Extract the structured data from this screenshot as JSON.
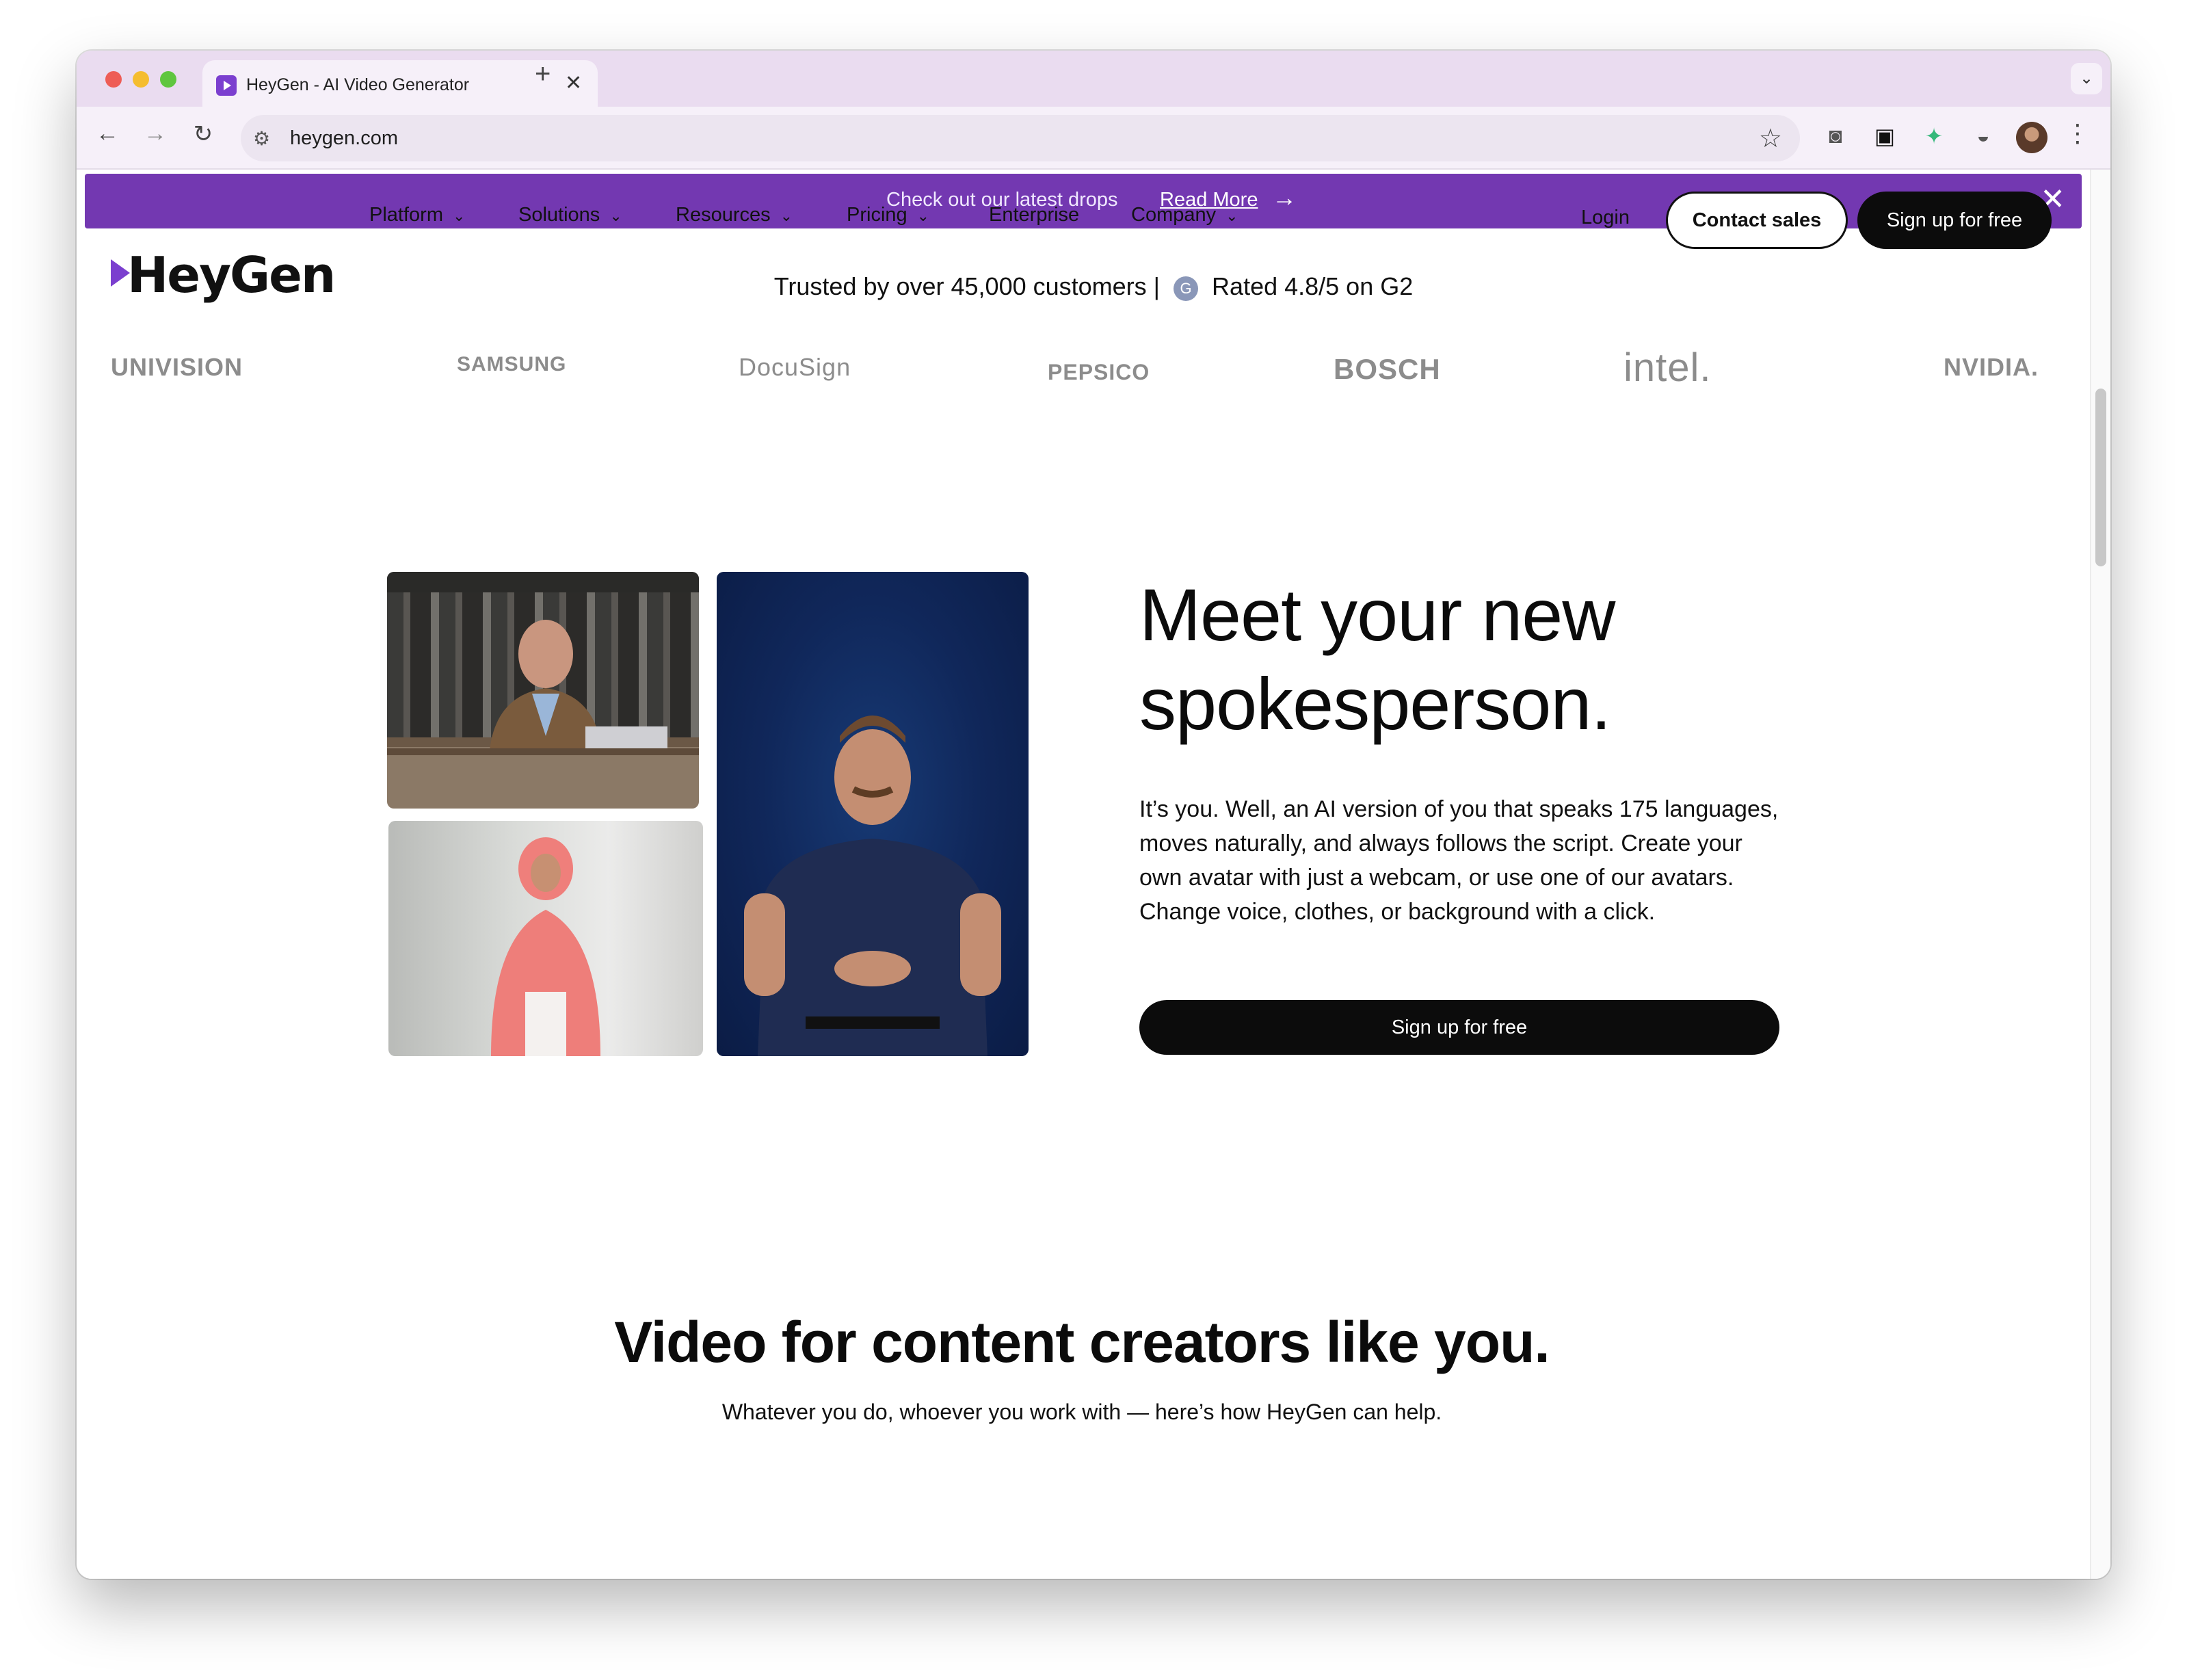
{
  "browser": {
    "tab_title": "HeyGen - AI Video Generator",
    "url": "heygen.com"
  },
  "banner": {
    "text": "Check out our latest drops",
    "link": "Read More"
  },
  "nav": {
    "logo": "HeyGen",
    "items": [
      "Platform",
      "Solutions",
      "Resources",
      "Pricing",
      "Enterprise",
      "Company"
    ],
    "login": "Login",
    "contact": "Contact sales",
    "signup": "Sign up for free"
  },
  "trust": {
    "customers": "Trusted by over 45,000 customers |",
    "rating": "Rated 4.8/5 on G2",
    "g2_badge": "G"
  },
  "logos": [
    "UNIVISION",
    "SAMSUNG",
    "DocuSign",
    "PEPSICO",
    "BOSCH",
    "intel.",
    "NVIDIA."
  ],
  "hero": {
    "title": "Meet your new spokesperson.",
    "body": "It’s you. Well, an AI version of you that speaks 175 languages, moves naturally, and always follows the script. Create your own avatar with just a webcam, or use one of our avatars. Change voice, clothes, or background with a click.",
    "cta": "Sign up for free"
  },
  "section": {
    "title": "Video for content creators like you.",
    "subtitle": "Whatever you do, whoever you work with — here’s how HeyGen can help."
  },
  "colors": {
    "banner": "#7338b1",
    "brand_accent": "#7b3fcf",
    "cta": "#0c0c0c"
  }
}
